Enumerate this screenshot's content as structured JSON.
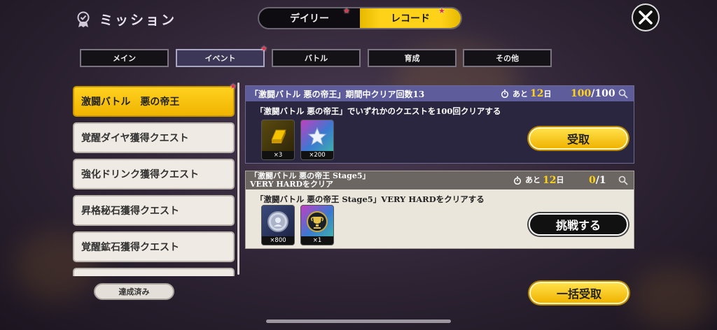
{
  "header": {
    "title": "ミッション",
    "toggle": {
      "daily_label": "デイリー",
      "record_label": "レコード",
      "active": "record"
    }
  },
  "category_tabs": [
    {
      "label": "メイン",
      "active": false,
      "badge": false
    },
    {
      "label": "イベント",
      "active": true,
      "badge": true
    },
    {
      "label": "バトル",
      "active": false,
      "badge": false
    },
    {
      "label": "育成",
      "active": false,
      "badge": false
    },
    {
      "label": "その他",
      "active": false,
      "badge": false
    }
  ],
  "sidebar": {
    "items": [
      {
        "label": "激闘バトル　悪の帝王",
        "active": true,
        "badge": true
      },
      {
        "label": "覚醒ダイヤ獲得クエスト",
        "active": false
      },
      {
        "label": "強化ドリンク獲得クエスト",
        "active": false
      },
      {
        "label": "昇格秘石獲得クエスト",
        "active": false
      },
      {
        "label": "覚醒鉱石獲得クエスト",
        "active": false
      }
    ],
    "done_button": "達成済み"
  },
  "missions": [
    {
      "title": "「激闘バトル 悪の帝王」期間中クリア回数13",
      "description": "「激闘バトル 悪の帝王」でいずれかのクエストを100回クリアする",
      "remaining_prefix": "あと",
      "remaining_days": "12",
      "remaining_suffix": "日",
      "progress_current": "100",
      "progress_total": "/100",
      "rewards": [
        {
          "icon": "gold-bar-icon",
          "count": "×3"
        },
        {
          "icon": "star-icon",
          "count": "×200"
        }
      ],
      "action_label": "受取"
    },
    {
      "title_line1": "「激闘バトル 悪の帝王 Stage5」",
      "title_line2": "VERY HARDをクリア",
      "description": "「激闘バトル 悪の帝王 Stage5」VERY HARDをクリアする",
      "remaining_prefix": "あと",
      "remaining_days": "12",
      "remaining_suffix": "日",
      "progress_current": "0",
      "progress_total": "/1",
      "rewards": [
        {
          "icon": "silver-medal-icon",
          "count": "×800"
        },
        {
          "icon": "trophy-icon",
          "count": "×1"
        }
      ],
      "action_label": "挑戦する"
    }
  ],
  "footer": {
    "claim_all_label": "一括受取"
  },
  "colors": {
    "accent": "#ffd21a",
    "badge": "#e0304a",
    "card1_header": "#5f5c9c",
    "card2_header": "#6b6662"
  }
}
